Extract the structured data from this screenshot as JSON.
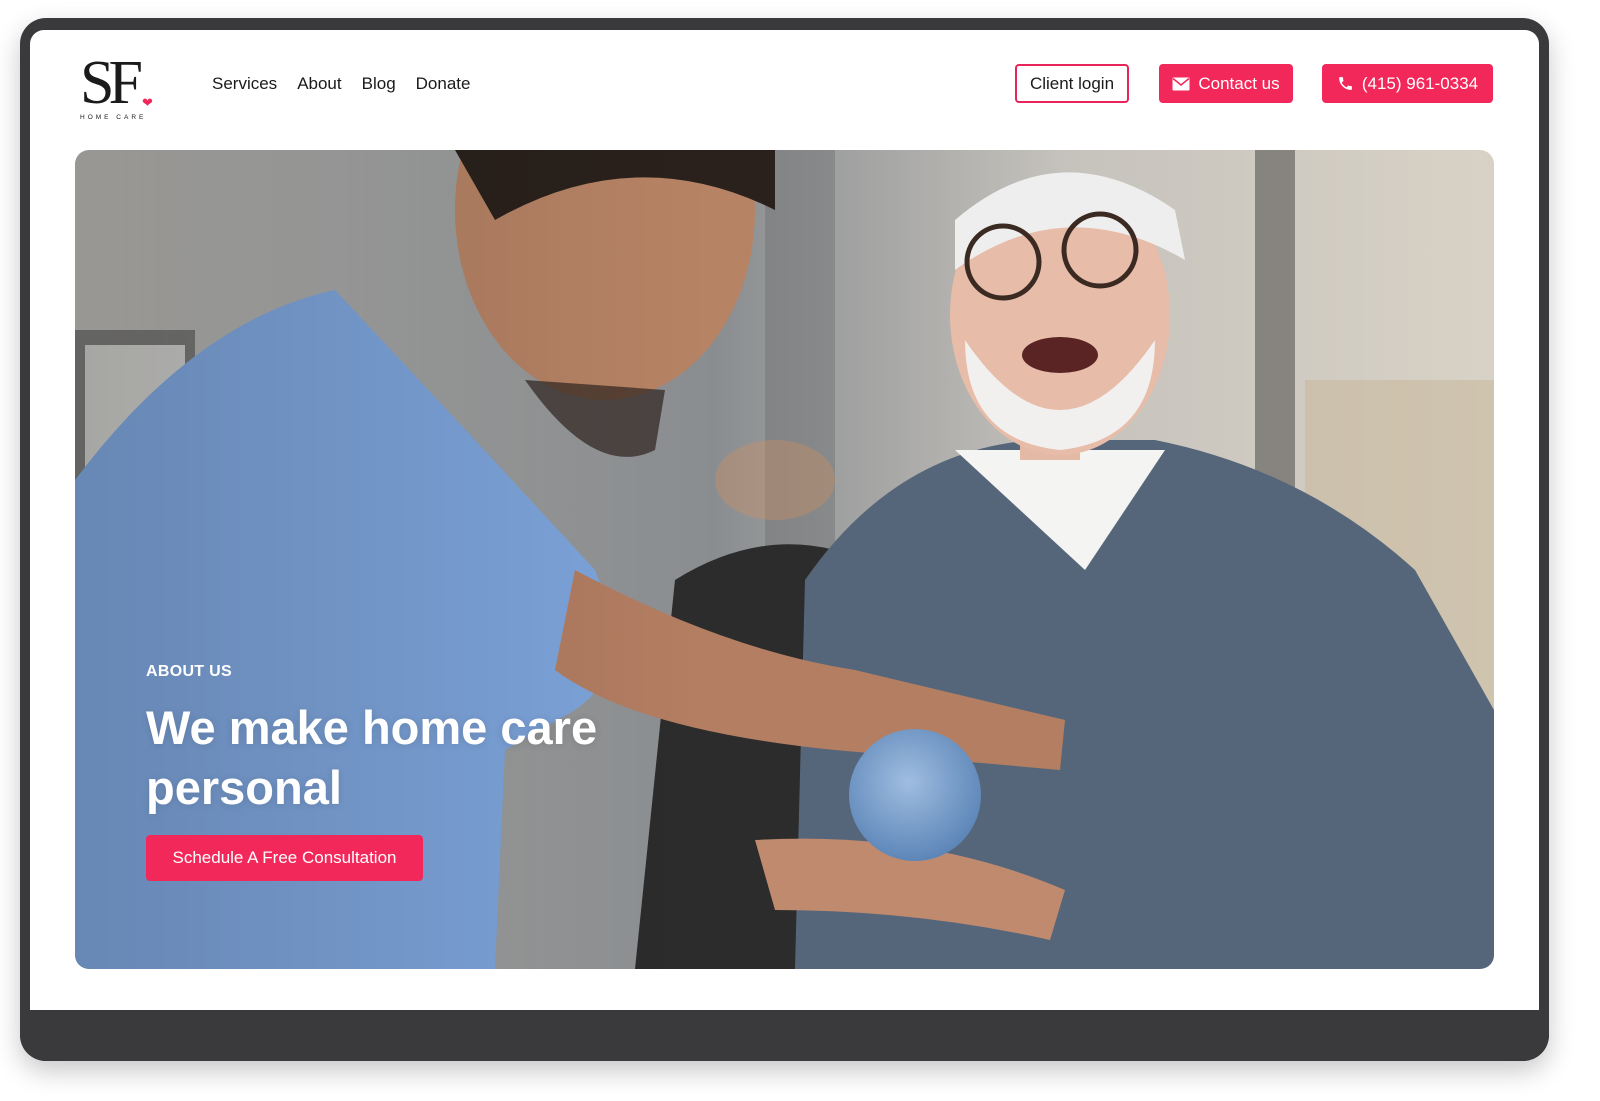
{
  "brand": {
    "logo_mark": "SF",
    "logo_subtitle": "HOME CARE",
    "accent_color": "#f2285a"
  },
  "nav": {
    "items": [
      {
        "label": "Services"
      },
      {
        "label": "About"
      },
      {
        "label": "Blog"
      },
      {
        "label": "Donate"
      }
    ]
  },
  "header_actions": {
    "client_login": "Client login",
    "contact": {
      "label": "Contact us",
      "icon": "envelope-icon"
    },
    "phone": {
      "label": "(415) 961-0334",
      "icon": "phone-icon"
    }
  },
  "hero": {
    "eyebrow": "ABOUT US",
    "title": "We make home care personal",
    "cta_label": "Schedule A Free Consultation",
    "image_subject": "caregiver-and-elderly-man-photo"
  }
}
